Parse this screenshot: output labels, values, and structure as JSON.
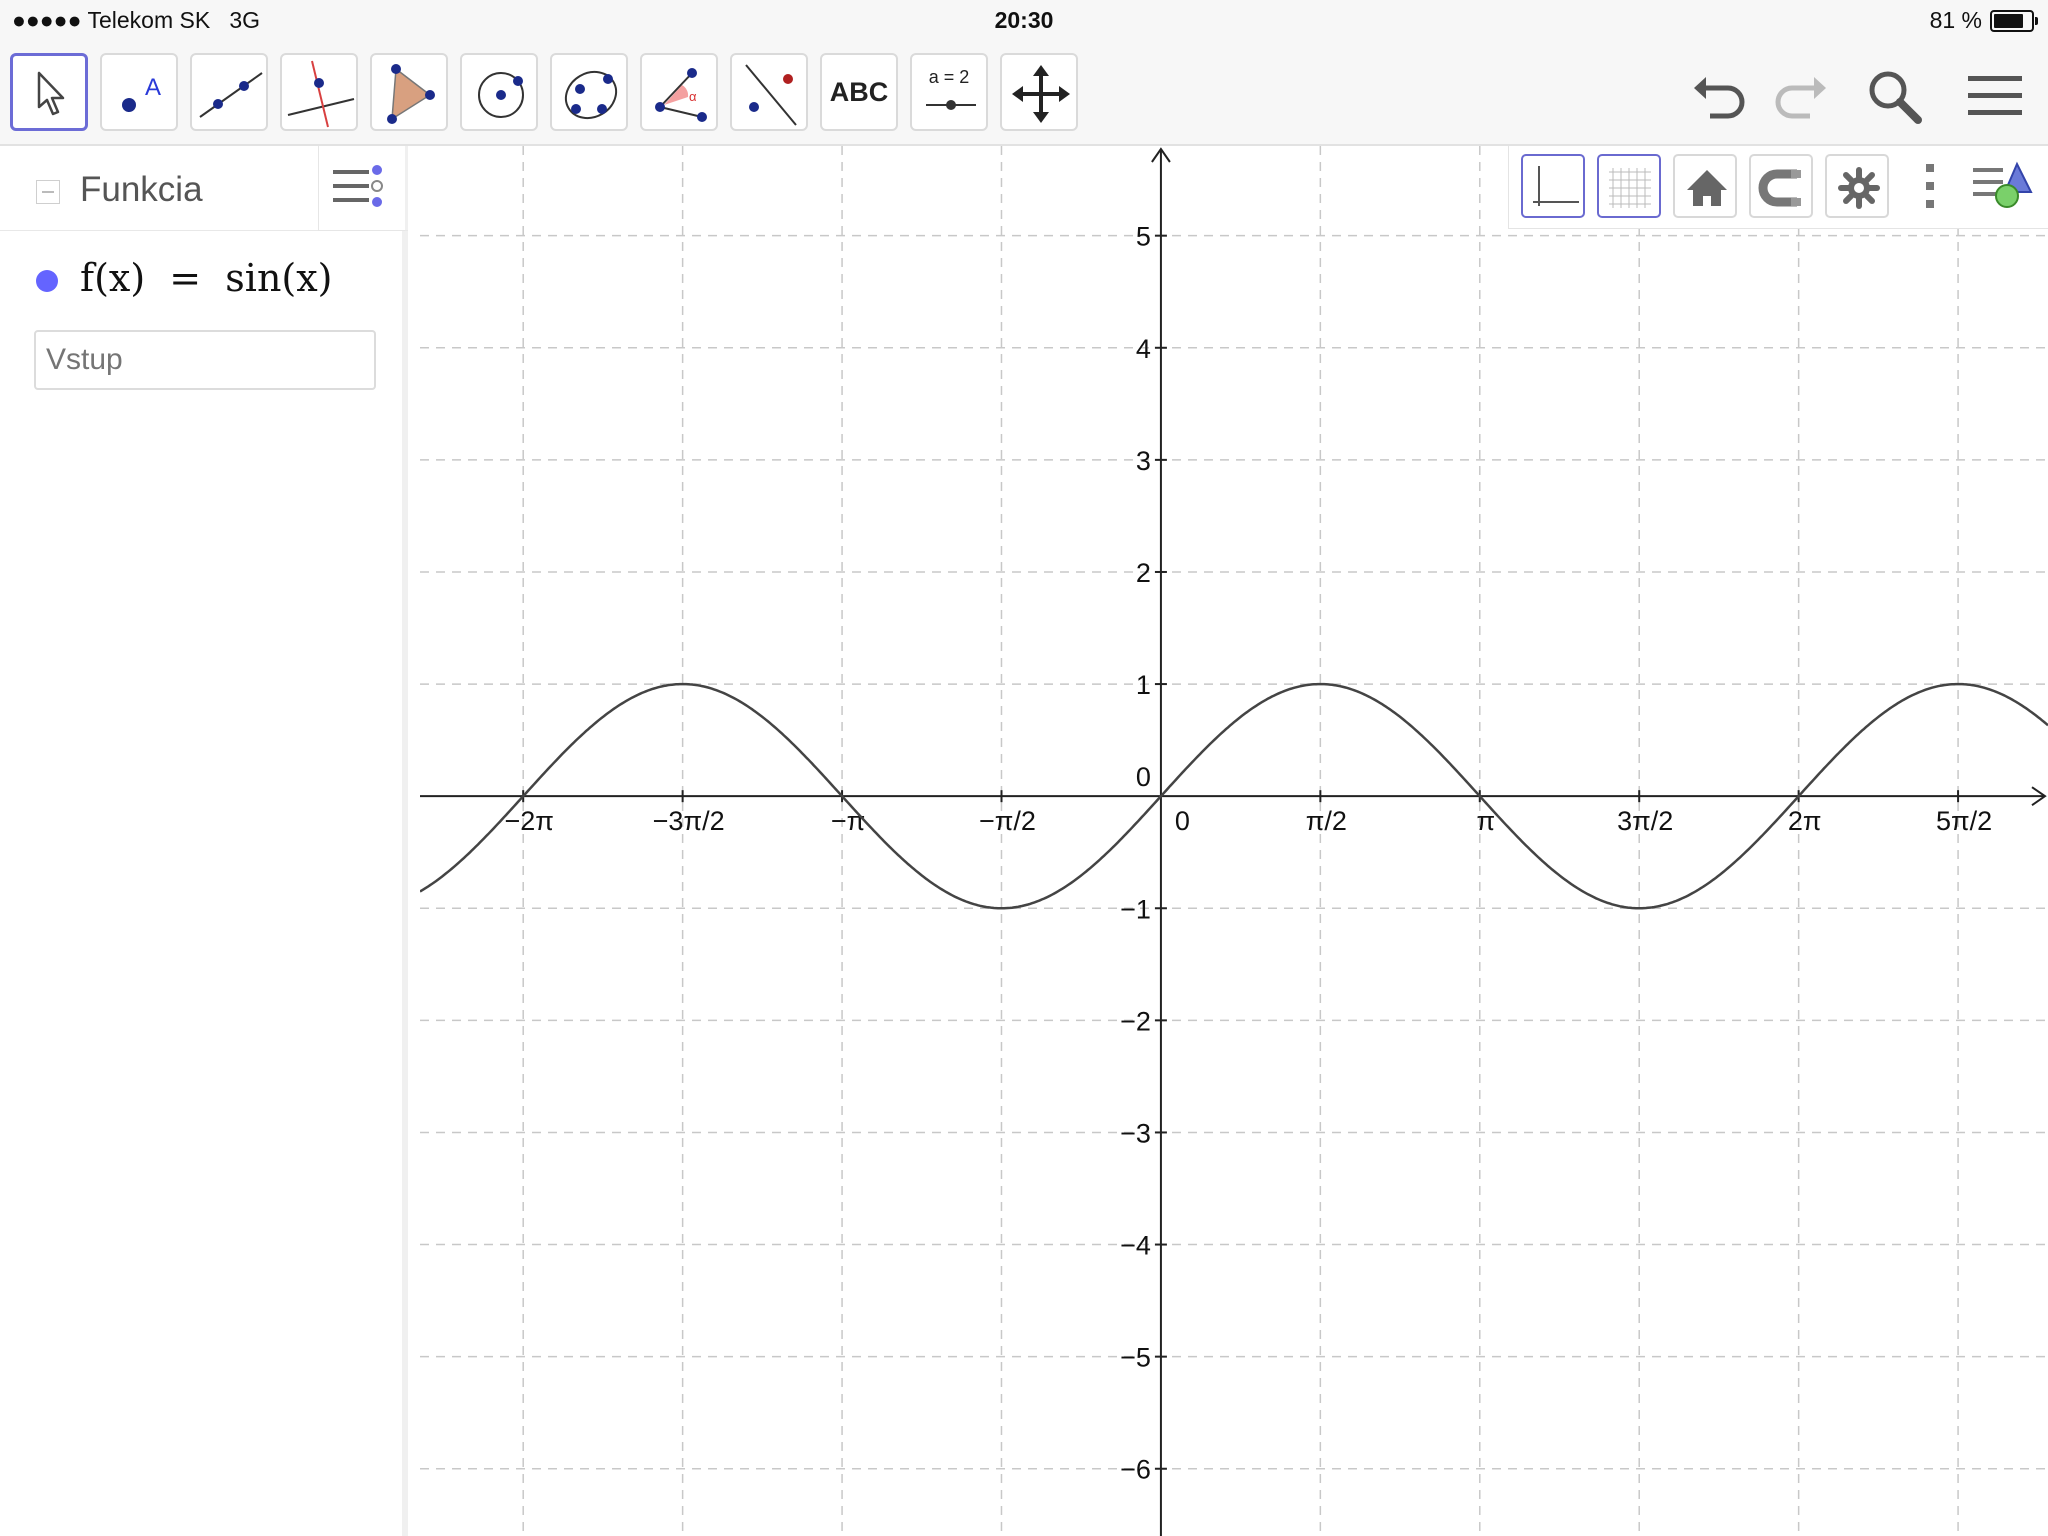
{
  "status_bar": {
    "signal": "●●●●●",
    "carrier": "Telekom SK",
    "network": "3G",
    "time": "20:30",
    "battery": "81 %",
    "battery_level": 0.81
  },
  "toolbar": {
    "text_tool_label": "ABC",
    "slider_tool_label": "a = 2",
    "accent_color": "#6c6cd6"
  },
  "algebra": {
    "group_title": "Funkcia",
    "function_text": "f(x)  =  sin(x)",
    "function_color": "#6464ff",
    "input_placeholder": "Vstup"
  },
  "chart_data": {
    "type": "line",
    "series": [
      {
        "name": "f(x) = sin(x)",
        "function": "sin",
        "color": "#444444"
      }
    ],
    "x_tick_labels": [
      "−2π",
      "−3π/2",
      "−π",
      "−π/2",
      "0",
      "π/2",
      "π",
      "3π/2",
      "2π",
      "5π/2"
    ],
    "x_tick_values": [
      -6.2832,
      -4.7124,
      -3.1416,
      -1.5708,
      0,
      1.5708,
      3.1416,
      4.7124,
      6.2832,
      7.854
    ],
    "y_tick_labels": [
      "5",
      "4",
      "3",
      "2",
      "1",
      "0",
      "−1",
      "−2",
      "−3",
      "−4",
      "−5",
      "−6"
    ],
    "y_tick_values": [
      5,
      4,
      3,
      2,
      1,
      0,
      -1,
      -2,
      -3,
      -4,
      -5,
      -6
    ],
    "xlim": [
      -7.3,
      8.74
    ],
    "ylim": [
      -6.6,
      5.8
    ],
    "grid": true,
    "grid_color": "#c8c8c8"
  }
}
